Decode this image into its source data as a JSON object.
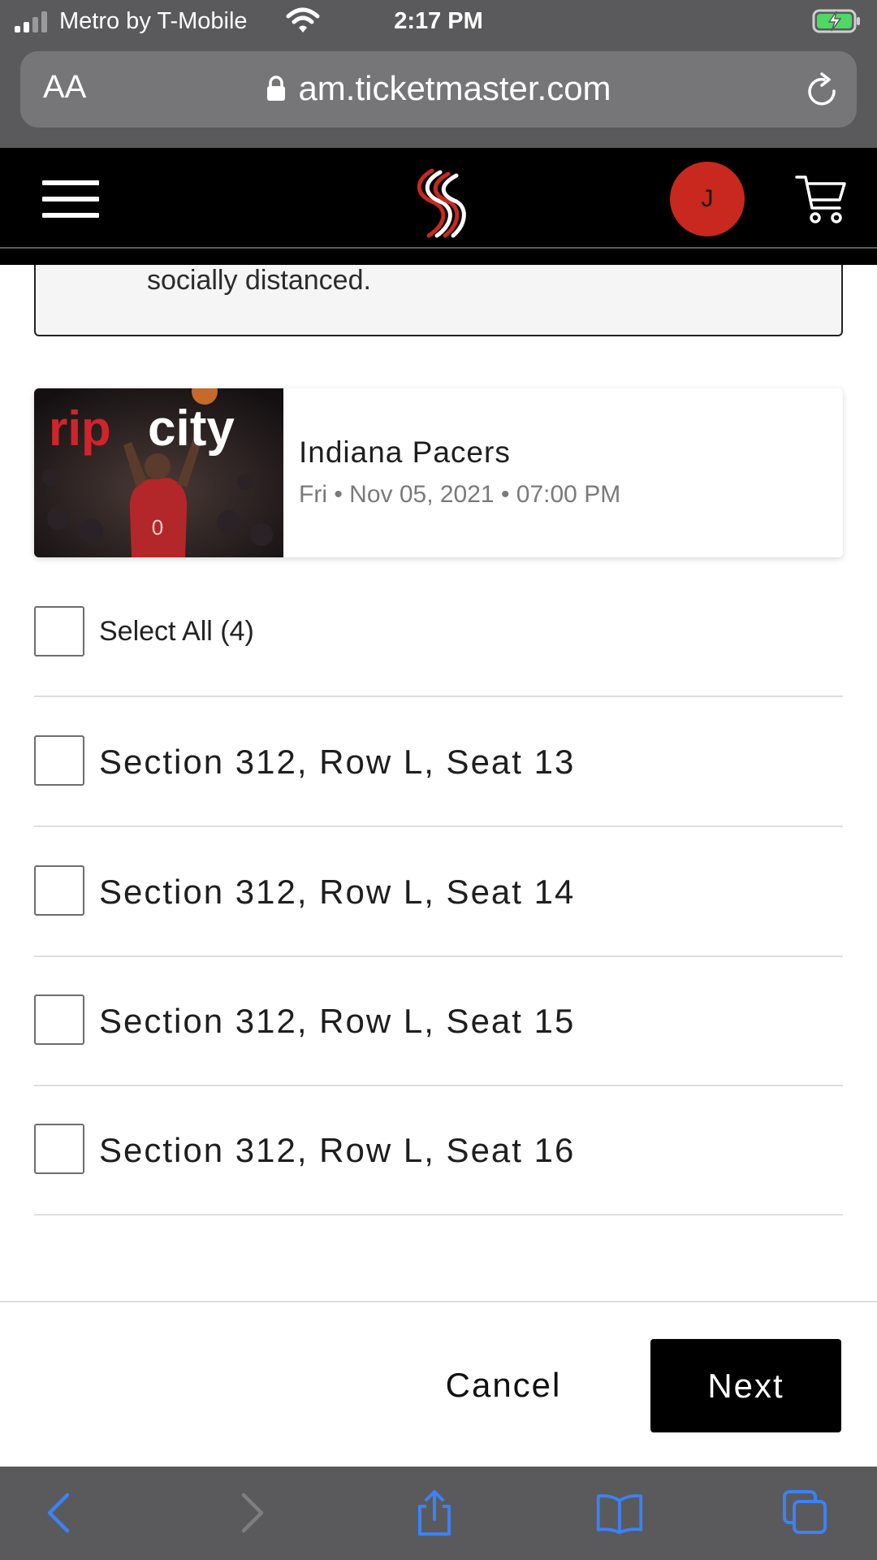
{
  "status_bar": {
    "carrier": "Metro by T-Mobile",
    "time": "2:17 PM"
  },
  "browser": {
    "text_size_label": "AA",
    "url": "am.ticketmaster.com"
  },
  "header": {
    "avatar_initial": "J"
  },
  "notice": {
    "text": "socially distanced."
  },
  "event": {
    "opponent": "Indiana Pacers",
    "date_line": "Fri • Nov 05, 2021 • 07:00 PM",
    "image_text": "ripcity"
  },
  "seats": {
    "select_all_label": "Select All (4)",
    "items": [
      {
        "label": "Section 312, Row L, Seat 13"
      },
      {
        "label": "Section 312, Row L, Seat 14"
      },
      {
        "label": "Section 312, Row L, Seat 15"
      },
      {
        "label": "Section 312, Row L, Seat 16"
      }
    ]
  },
  "actions": {
    "cancel_label": "Cancel",
    "next_label": "Next"
  },
  "colors": {
    "brand_red": "#c8281e",
    "header_bg": "#000000",
    "browser_chrome": "#5a5a5c",
    "ios_blue": "#3b82f6"
  },
  "icons": {
    "status": [
      "signal-icon",
      "wifi-icon",
      "battery-charging-icon"
    ],
    "browser": [
      "lock-icon",
      "reload-icon"
    ],
    "header": [
      "hamburger-menu-icon",
      "trail-blazers-logo",
      "cart-icon"
    ],
    "toolbar": [
      "back-icon",
      "forward-icon",
      "share-icon",
      "bookmarks-icon",
      "tabs-icon"
    ]
  }
}
